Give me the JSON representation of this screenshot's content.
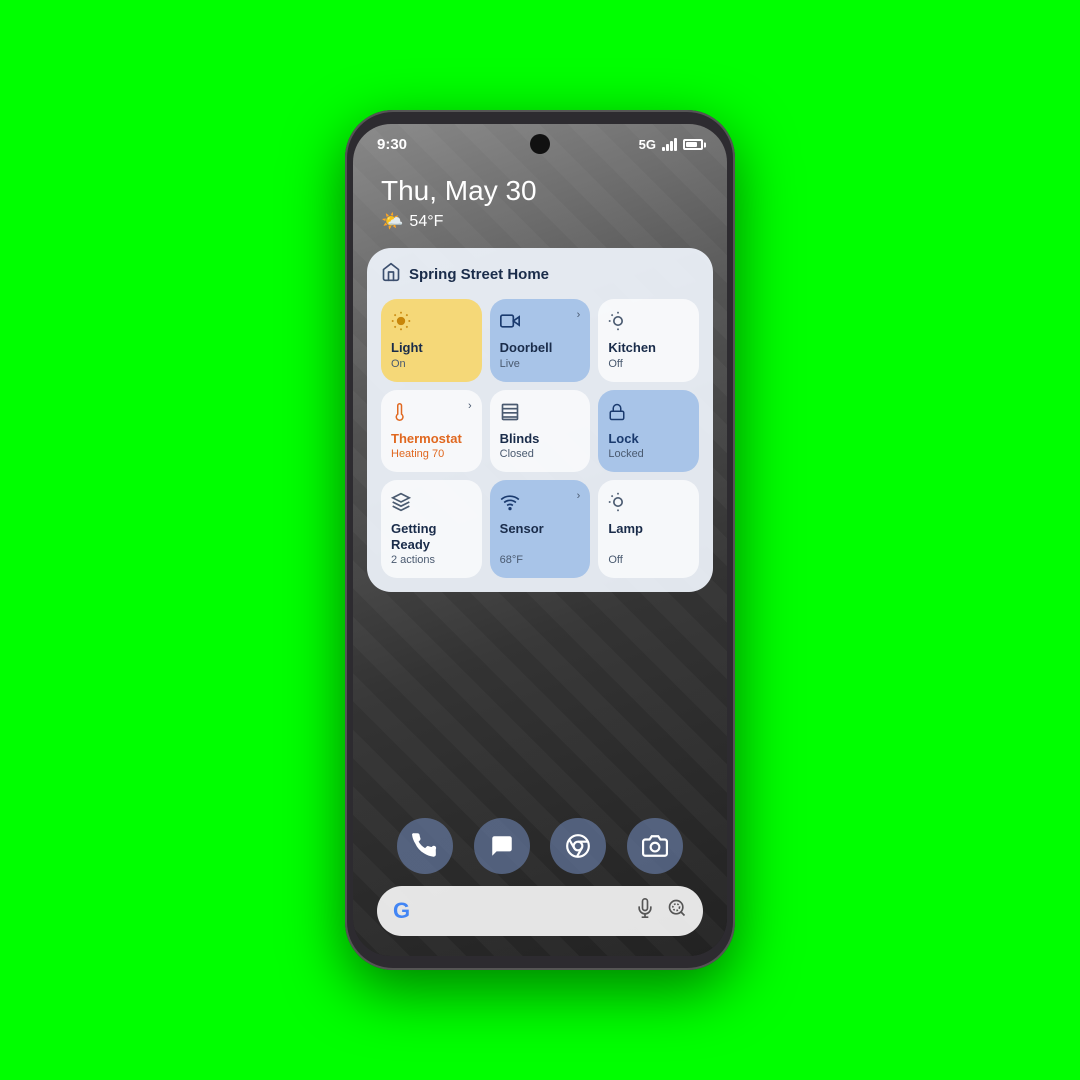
{
  "status_bar": {
    "time": "9:30",
    "signal": "5G"
  },
  "date": "Thu, May 30",
  "weather": {
    "icon": "🌤️",
    "temp": "54°F"
  },
  "widget": {
    "title": "Spring Street Home",
    "home_icon": "🏠",
    "tiles": [
      {
        "id": "light",
        "icon": "💡",
        "name": "Light",
        "status": "On",
        "style": "yellow"
      },
      {
        "id": "doorbell",
        "icon": "📷",
        "name": "Doorbell",
        "status": "Live",
        "style": "blue",
        "has_arrow": true
      },
      {
        "id": "kitchen",
        "icon": "💡",
        "name": "Kitchen",
        "status": "Off",
        "style": "default"
      },
      {
        "id": "thermostat",
        "icon": "🌡️",
        "name": "Thermostat",
        "status": "Heating 70",
        "style": "default",
        "has_arrow": true
      },
      {
        "id": "blinds",
        "icon": "⬛",
        "name": "Blinds",
        "status": "Closed",
        "style": "default"
      },
      {
        "id": "lock",
        "icon": "🔒",
        "name": "Lock",
        "status": "Locked",
        "style": "blue"
      },
      {
        "id": "getting-ready",
        "icon": "✨",
        "name": "Getting Ready",
        "status": "2 actions",
        "style": "default"
      },
      {
        "id": "sensor",
        "icon": "📡",
        "name": "Sensor",
        "status": "68°F",
        "style": "blue",
        "has_arrow": true
      },
      {
        "id": "lamp",
        "icon": "💡",
        "name": "Lamp",
        "status": "Off",
        "style": "default"
      }
    ]
  },
  "dock": {
    "icons": [
      {
        "name": "phone",
        "symbol": "📞"
      },
      {
        "name": "messages",
        "symbol": "💬"
      },
      {
        "name": "chrome",
        "symbol": "🌐"
      },
      {
        "name": "camera",
        "symbol": "📷"
      }
    ]
  },
  "search_bar": {
    "google_label": "G",
    "mic_icon": "mic",
    "lens_icon": "lens"
  }
}
